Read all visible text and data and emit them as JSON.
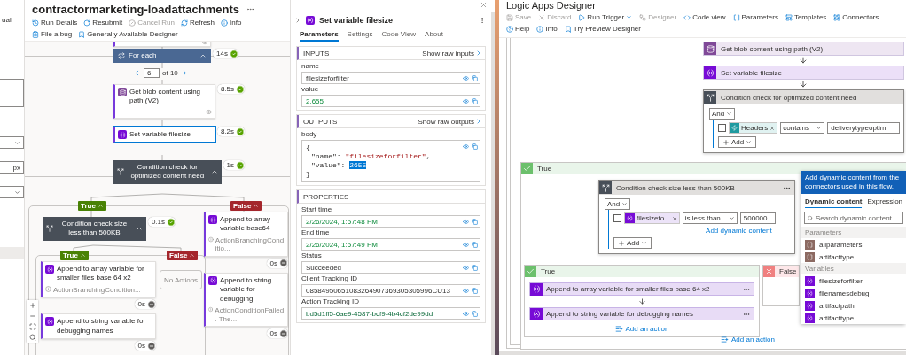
{
  "side_strip": {
    "texts": [
      "ual",
      "px"
    ]
  },
  "run": {
    "title": "contractormarketing-loadattachments",
    "toolbar": [
      {
        "label": "Run Details",
        "disabled": false
      },
      {
        "label": "Resubmit",
        "disabled": false
      },
      {
        "label": "Cancel Run",
        "disabled": true
      },
      {
        "label": "Refresh",
        "disabled": false
      },
      {
        "label": "Info",
        "disabled": false
      },
      {
        "label": "File a bug",
        "disabled": false
      },
      {
        "label": "Generally Available Designer",
        "disabled": false
      }
    ],
    "pager": {
      "current": "6",
      "total": "of 10"
    },
    "nodes": [
      {
        "kind": "loop",
        "title": "For each",
        "duration": "14s",
        "succeeded": true,
        "selected": false
      },
      {
        "kind": "blob_action",
        "title": "Get blob content using path (V2)",
        "duration": "8.5s",
        "succeeded": true,
        "selected": false
      },
      {
        "kind": "variable_action",
        "title": "Set variable filesize",
        "duration": "8.2s",
        "succeeded": true,
        "selected": true
      },
      {
        "kind": "condition",
        "title": "Condition check for optimized content need",
        "duration": "1s",
        "succeeded": true,
        "selected": false
      },
      {
        "kind": "true_branch",
        "label": "True"
      },
      {
        "kind": "false_branch",
        "label": "False"
      },
      {
        "kind": "condition",
        "title": "Condition check size less than 500KB",
        "duration": "0.1s",
        "succeeded": true,
        "selected": false
      },
      {
        "kind": "true_branch",
        "label": "True"
      },
      {
        "kind": "false_branch",
        "label": "False"
      },
      {
        "kind": "empty",
        "label": "No Actions"
      },
      {
        "kind": "variable_action",
        "title": "Append to array variable for smaller files base 64 x2",
        "note": "ActionBranchingCondition...",
        "duration": "0s",
        "succeeded": false,
        "selected": false
      },
      {
        "kind": "variable_action",
        "title": "Append to string variable for debugging names",
        "duration": "0s",
        "succeeded": false,
        "selected": false
      },
      {
        "kind": "variable_action",
        "title": "Append to array variable base64",
        "note": "ActionBranchingConditio...",
        "duration": "0s",
        "succeeded": false,
        "selected": false
      },
      {
        "kind": "variable_action",
        "title": "Append to string variable for debugging",
        "note": "ActionConditionFailed. The...",
        "duration": "0s",
        "succeeded": false,
        "selected": false
      }
    ]
  },
  "details": {
    "title": "Set variable filesize",
    "tabs": [
      {
        "label": "Parameters",
        "selected": true
      },
      {
        "label": "Settings",
        "selected": false
      },
      {
        "label": "Code View",
        "selected": false
      },
      {
        "label": "About",
        "selected": false
      }
    ],
    "sections": [
      {
        "heading": "INPUTS",
        "raw_link": "Show raw inputs",
        "fields": [
          {
            "label": "name",
            "kind": "text",
            "value": "filesizeforfilter"
          },
          {
            "label": "value",
            "kind": "number",
            "value": "2,655"
          }
        ]
      },
      {
        "heading": "OUTPUTS",
        "raw_link": "Show raw outputs",
        "fields": [
          {
            "label": "body",
            "kind": "json",
            "open": "{",
            "close": "}",
            "entries": [
              {
                "key": "\"name\": ",
                "value": "\"filesizeforfilter\"",
                "kind": "string",
                "trail": ",",
                "highlighted": false
              },
              {
                "key": "\"value\": ",
                "value": "2655",
                "kind": "number",
                "highlighted": true
              }
            ]
          }
        ]
      },
      {
        "heading": "PROPERTIES",
        "fields": [
          {
            "label": "Start time",
            "kind": "date",
            "value": "2/26/2024, 1:57:48 PM"
          },
          {
            "label": "End time",
            "kind": "date",
            "value": "2/26/2024, 1:57:49 PM"
          },
          {
            "label": "Status",
            "kind": "text",
            "value": "Succeeded"
          },
          {
            "label": "Client Tracking ID",
            "kind": "text",
            "value": "08584950651083264907369305305996CU13"
          },
          {
            "label": "Action Tracking ID",
            "kind": "guid",
            "value": "bd5d1ff5-6ae9-4587-bcf9-4b4cf2de99dd"
          }
        ]
      }
    ]
  },
  "designer": {
    "title": "Logic Apps Designer",
    "toolbar": [
      {
        "label": "Save",
        "disabled": true,
        "menu": false
      },
      {
        "label": "Discard",
        "disabled": true,
        "menu": false
      },
      {
        "label": "Run Trigger",
        "disabled": false,
        "menu": true
      },
      {
        "label": "Designer",
        "disabled": true,
        "menu": false
      },
      {
        "label": "Code view",
        "disabled": false,
        "menu": false
      },
      {
        "label": "Parameters",
        "disabled": false,
        "menu": false
      },
      {
        "label": "Templates",
        "disabled": false,
        "menu": false
      },
      {
        "label": "Connectors",
        "disabled": false,
        "menu": false
      },
      {
        "label": "Help",
        "disabled": false,
        "menu": false
      },
      {
        "label": "Info",
        "disabled": false,
        "menu": false
      },
      {
        "label": "Try Preview Designer",
        "disabled": false,
        "menu": false
      }
    ],
    "steps": [
      {
        "kind": "blob_action",
        "title": "Get blob content using path (V2)"
      },
      {
        "kind": "variable_action",
        "title": "Set variable filesize"
      }
    ],
    "condition": {
      "title": "Condition check for optimized content need",
      "operator": "And",
      "rows": [
        {
          "checked": false,
          "token": "Headers",
          "kind": "trigger",
          "operator": "contains",
          "value": "deliverytypeoptim"
        }
      ],
      "add_label": "Add",
      "true_branch": {
        "label": "True",
        "condition": {
          "title": "Condition check size less than 500KB",
          "operator": "And",
          "rows": [
            {
              "checked": false,
              "token": "filesizefo...",
              "kind": "variable",
              "operator": "is less than",
              "value": "500000"
            }
          ],
          "link": "Add dynamic content",
          "add_label": "Add",
          "true_branch": {
            "label": "True",
            "actions": [
              {
                "title": "Append to array variable for smaller files base 64 x2"
              },
              {
                "title": "Append to string variable for debugging names"
              }
            ],
            "add_action": "Add an action"
          },
          "false_branch": {
            "label": "False"
          }
        },
        "add_action": "Add an action"
      }
    },
    "dynamic_content": {
      "header": "Add dynamic content from the connectors used in this flow.",
      "tabs": [
        {
          "label": "Dynamic content",
          "selected": true
        },
        {
          "label": "Expression",
          "selected": false
        }
      ],
      "search_placeholder": "Search dynamic content",
      "groups": [
        {
          "heading": "Parameters",
          "items": [
            {
              "label": "allparameters",
              "kind": "parameter"
            },
            {
              "label": "artifacttype",
              "kind": "parameter"
            }
          ]
        },
        {
          "heading": "Variables",
          "items": [
            {
              "label": "filesizeforfilter",
              "kind": "variable"
            },
            {
              "label": "filenamesdebug",
              "kind": "variable"
            },
            {
              "label": "artifactpath",
              "kind": "variable"
            },
            {
              "label": "artifacttype",
              "kind": "variable"
            }
          ]
        }
      ]
    }
  }
}
